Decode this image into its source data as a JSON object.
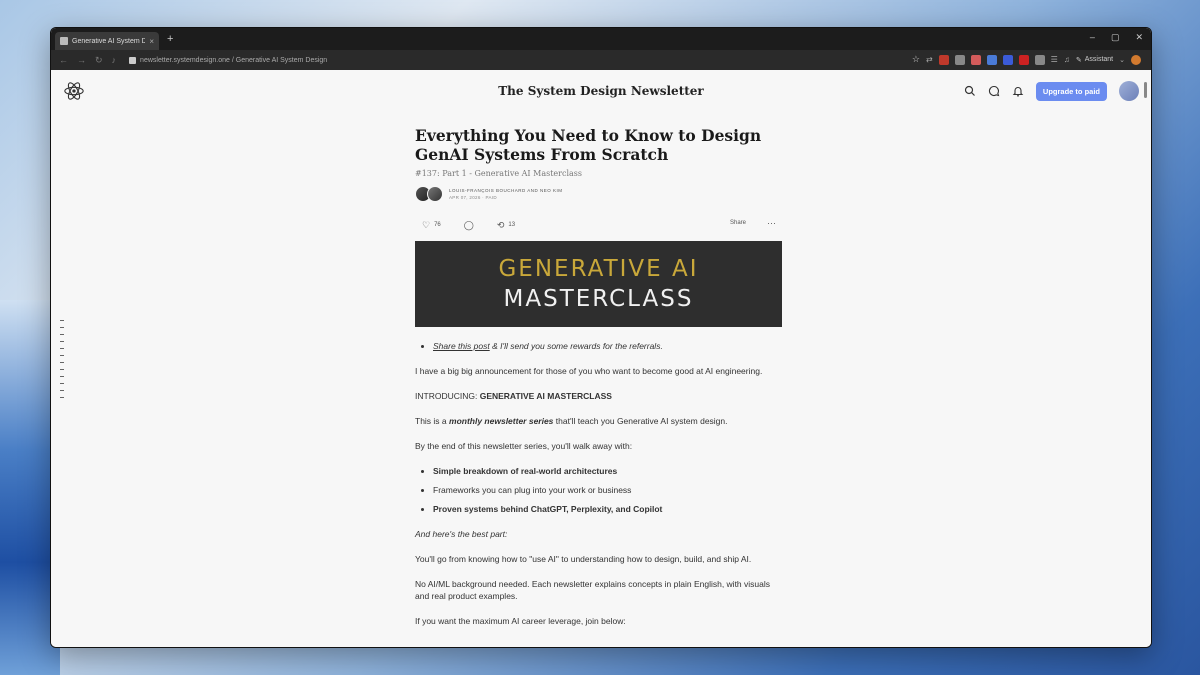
{
  "browser": {
    "tab_title": "Generative AI System Desi",
    "tab_close": "×",
    "new_tab": "+",
    "url": "newsletter.systemdesign.one / Generative AI System Design",
    "assistant_label": "Assistant",
    "window_controls": [
      "–",
      "▢",
      "✕"
    ],
    "extension_colors": [
      "#c0392b",
      "#888888",
      "#d35b5b",
      "#4a7bd8",
      "#3b5bd8",
      "#cc2222",
      "#888888",
      "#d27a2f"
    ]
  },
  "header": {
    "site_title": "The System Design Newsletter",
    "upgrade_label": "Upgrade to paid"
  },
  "article": {
    "title": "Everything You Need to Know to Design GenAI Systems From Scratch",
    "subtitle": "#137: Part 1 - Generative AI Masterclass",
    "authors": "LOUIS-FRANÇOIS BOUCHARD AND NEO KIM",
    "date": "APR 07, 2026 · PAID",
    "likes": "76",
    "restacks": "13",
    "share_label": "Share",
    "more": "···",
    "hero_line1": "GENERATIVE AI",
    "hero_line2": "MASTERCLASS",
    "share_link": "Share this post",
    "share_rest": " & I'll send you some rewards for the referrals.",
    "p1": "I have a big big announcement for those of you who want to become good at AI engineering.",
    "p2_pre": "INTRODUCING: ",
    "p2_bold": "GENERATIVE AI MASTERCLASS",
    "p3_pre": "This is a ",
    "p3_em": "monthly newsletter series",
    "p3_post": " that'll teach you Generative AI system design.",
    "p4": "By the end of this newsletter series, you'll walk away with:",
    "bullets": [
      "Simple breakdown of real-world architectures",
      "Frameworks you can plug into your work or business",
      "Proven systems behind ChatGPT, Perplexity, and Copilot"
    ],
    "p5": "And here's the best part:",
    "p6": "You'll go from knowing how to \"use AI\" to understanding how to design, build, and ship AI.",
    "p7": "No AI/ML background needed. Each newsletter explains concepts in plain English, with visuals and real product examples.",
    "p8": "If you want the maximum AI career leverage, join below:"
  }
}
